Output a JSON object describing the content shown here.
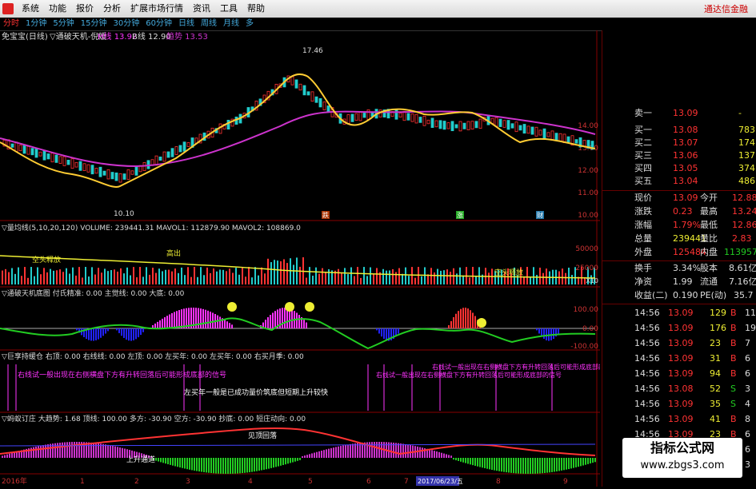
{
  "menu": {
    "items": [
      "系统",
      "功能",
      "报价",
      "分析",
      "扩展市场行情",
      "资讯",
      "工具",
      "帮助"
    ],
    "broker": "通达信金融"
  },
  "periods": [
    "分时",
    "1分钟",
    "5分钟",
    "15分钟",
    "30分钟",
    "60分钟",
    "日线",
    "周线",
    "月线",
    "多"
  ],
  "main_chart": {
    "header_stock": "免宝宝(日线)",
    "header_indicator": "▽通破天机-倪媛",
    "header_line1": "H线 13.92",
    "header_line2": "B线 12.90",
    "header_trend": "趋势 13.53",
    "high_label": "17.46",
    "low_label": "10.10",
    "price_ticks": [
      "14.00",
      "13.00",
      "12.00",
      "11.00",
      "10.00"
    ],
    "markers": [
      "跌",
      "涨",
      "财"
    ]
  },
  "volume_panel": {
    "header": "▽量均线(5,10,20,120)  VOLUME: 239441.31  MAVOL1: 112879.90  MAVOL2: 108869.0",
    "label_left": "空头释放",
    "label_top": "高出",
    "label_right": "空头释放",
    "ticks": [
      "50000",
      "25000"
    ],
    "unit": "X10"
  },
  "osc_panel": {
    "header": "▽通破天机底图  付氏精准: 0.00  主觉线: 0.00  大底: 0.00",
    "ticks": [
      "100.00",
      "0.00",
      "-100.00"
    ]
  },
  "signal_panel": {
    "header": "▽巨享持缓仓  右顶: 0.00  右线线: 0.00  左顶: 0.00  左买年: 0.00  左买年: 0.00  右买月季: 0.00",
    "box_left": "右线试一般出现在右侧横盘下方有升转回落后可能形成底部的信号",
    "box_mid": "左买年一般是已成功量价筑底但短期上升较快",
    "box_right": "右线试一般出现在右侧横盘下方有升转回落后可能形成底部的信号",
    "box_far": "右线试一般出现在右侧横盘下方有升转回落后可能形成底部的信号"
  },
  "trend_panel": {
    "header": "▽蚂蚁订庄  大趋势: 1.68  顶线: 100.00  多方: -30.90  空方: -30.90  抄底: 0.00  短庄动向: 0.00",
    "label_top": "见顶回落",
    "label_bottom": "上升通道"
  },
  "xaxis": {
    "labels": [
      "2016年",
      "1",
      "2",
      "3",
      "4",
      "5",
      "6",
      "7",
      "8",
      "9"
    ],
    "date_highlight": "2017/06/23/五"
  },
  "quote_panel": {
    "order_book": [
      {
        "label": "卖一",
        "price": "13.09",
        "vol": "-"
      },
      {
        "label": "买一",
        "price": "13.08",
        "vol": "783"
      },
      {
        "label": "买二",
        "price": "13.07",
        "vol": "174"
      },
      {
        "label": "买三",
        "price": "13.06",
        "vol": "137"
      },
      {
        "label": "买四",
        "price": "13.05",
        "vol": "374"
      },
      {
        "label": "买五",
        "price": "13.04",
        "vol": "486"
      }
    ],
    "stats": [
      {
        "l1": "现价",
        "v1": "13.09",
        "l2": "今开",
        "v2": "12.88"
      },
      {
        "l1": "涨跌",
        "v1": "0.23",
        "l2": "最高",
        "v2": "13.24"
      },
      {
        "l1": "涨幅",
        "v1": "1.79%",
        "l2": "最低",
        "v2": "12.86"
      },
      {
        "l1": "总量",
        "v1": "239441",
        "l2": "量比",
        "v2": "2.83"
      },
      {
        "l1": "外盘",
        "v1": "125484",
        "l2": "内盘",
        "v2": "113957"
      }
    ],
    "stats2": [
      {
        "l1": "换手",
        "v1": "3.34%",
        "l2": "股本",
        "v2": "8.61亿"
      },
      {
        "l1": "净资",
        "v1": "1.99",
        "l2": "流通",
        "v2": "7.16亿"
      },
      {
        "l1": "收益(二)",
        "v1": "0.190",
        "l2": "PE(动)",
        "v2": "35.7"
      }
    ],
    "trades": [
      {
        "time": "14:56",
        "price": "13.09",
        "vol": "129",
        "bs": "B",
        "n": "11"
      },
      {
        "time": "14:56",
        "price": "13.09",
        "vol": "176",
        "bs": "B",
        "n": "19"
      },
      {
        "time": "14:56",
        "price": "13.09",
        "vol": "23",
        "bs": "B",
        "n": "7"
      },
      {
        "time": "14:56",
        "price": "13.09",
        "vol": "31",
        "bs": "B",
        "n": "6"
      },
      {
        "time": "14:56",
        "price": "13.09",
        "vol": "94",
        "bs": "B",
        "n": "6"
      },
      {
        "time": "14:56",
        "price": "13.08",
        "vol": "52",
        "bs": "S",
        "n": "3"
      },
      {
        "time": "14:56",
        "price": "13.09",
        "vol": "35",
        "bs": "S",
        "n": "4"
      },
      {
        "time": "14:56",
        "price": "13.09",
        "vol": "41",
        "bs": "B",
        "n": "8"
      },
      {
        "time": "14:56",
        "price": "13.09",
        "vol": "23",
        "bs": "B",
        "n": "6"
      },
      {
        "time": "14:56",
        "price": "13.09",
        "vol": "13",
        "bs": "B",
        "n": "6"
      },
      {
        "time": "14:56",
        "price": "13.08",
        "vol": "10",
        "bs": "S",
        "n": "3"
      }
    ]
  },
  "watermark": {
    "title": "指标公式网",
    "url": "www.zbgs3.com"
  },
  "colors": {
    "up": "#ff3333",
    "down": "#22cc22",
    "ma_trend": "#cc33cc",
    "ma_fast": "#ffcc33"
  }
}
